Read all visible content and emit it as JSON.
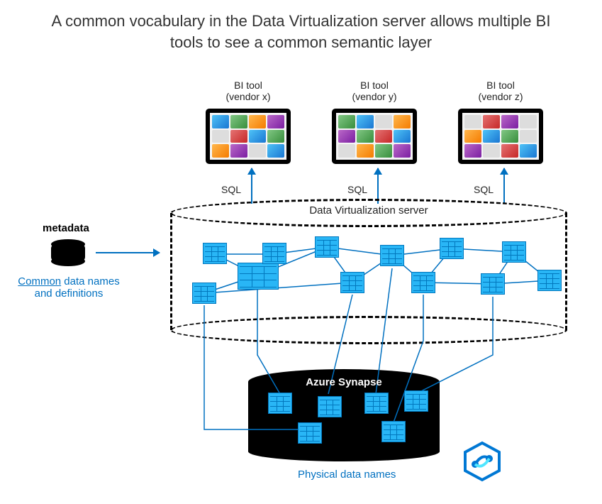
{
  "title": "A common vocabulary in the Data Virtualization server allows multiple BI tools to see a common semantic layer",
  "bi_tools": [
    {
      "name": "BI tool",
      "vendor": "(vendor x)",
      "sql": "SQL"
    },
    {
      "name": "BI tool",
      "vendor": "(vendor y)",
      "sql": "SQL"
    },
    {
      "name": "BI tool",
      "vendor": "(vendor z)",
      "sql": "SQL"
    }
  ],
  "dv_server": {
    "label": "Data Virtualization server"
  },
  "metadata": {
    "label": "metadata",
    "description_underlined": "Common",
    "description_rest": " data names and definitions"
  },
  "synapse": {
    "label": "Azure Synapse",
    "physical_label": "Physical data names"
  },
  "colors": {
    "link": "#0070c0",
    "table_fill": "#29b6f6",
    "table_border": "#0277bd"
  }
}
